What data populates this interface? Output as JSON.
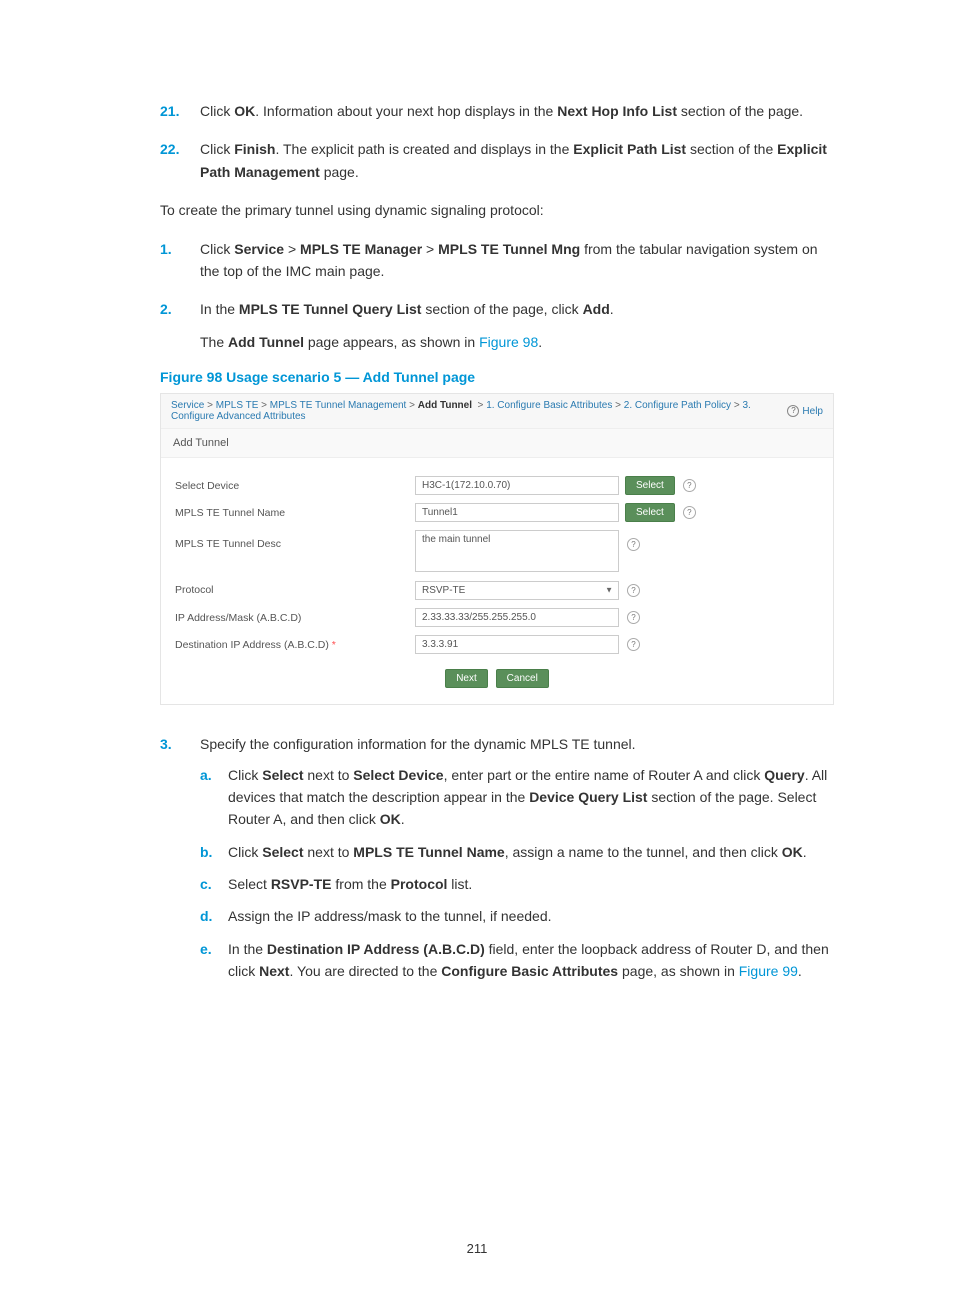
{
  "steps_top": [
    {
      "num": "21.",
      "html": "Click <b>OK</b>. Information about your next hop displays in the <b>Next Hop Info List</b> section of the page."
    },
    {
      "num": "22.",
      "html": "Click <b>Finish</b>. The explicit path is created and displays in the <b>Explicit Path List</b> section of the <b>Explicit Path Management</b> page."
    }
  ],
  "intro": "To create the primary tunnel using dynamic signaling protocol:",
  "steps_mid": [
    {
      "num": "1.",
      "html": "Click <b>Service</b> > <b>MPLS TE Manager</b> > <b>MPLS TE Tunnel Mng</b> from the tabular navigation system on the top of the IMC main page."
    },
    {
      "num": "2.",
      "html": "In the <b>MPLS TE Tunnel Query List</b> section of the page, click <b>Add</b>."
    }
  ],
  "step2_extra_html": "The <b>Add Tunnel</b> page appears, as shown in <span class=\"linkish\">Figure 98</span>.",
  "figure_caption": "Figure 98 Usage scenario 5 — Add Tunnel page",
  "screenshot": {
    "breadcrumb": {
      "service": "Service",
      "mpls_te": "MPLS TE",
      "mpls_te_tunnel_mgmt": "MPLS TE Tunnel Management",
      "add_tunnel": "Add Tunnel",
      "step1": "1. Configure Basic Attributes",
      "step2": "2. Configure Path Policy",
      "step3": "3. Configure Advanced Attributes",
      "help": "Help"
    },
    "panel_title": "Add Tunnel",
    "form": {
      "select_device": {
        "label": "Select Device",
        "value": "H3C-1(172.10.0.70)",
        "button": "Select"
      },
      "tunnel_name": {
        "label": "MPLS TE Tunnel Name",
        "value": "Tunnel1",
        "button": "Select"
      },
      "tunnel_desc": {
        "label": "MPLS TE Tunnel Desc",
        "value": "the main tunnel"
      },
      "protocol": {
        "label": "Protocol",
        "value": "RSVP-TE"
      },
      "ip_mask": {
        "label": "IP Address/Mask (A.B.C.D)",
        "value": "2.33.33.33/255.255.255.0"
      },
      "dest_ip": {
        "label": "Destination IP Address (A.B.C.D)",
        "value": "3.3.3.91",
        "required": "*"
      }
    },
    "buttons": {
      "next": "Next",
      "cancel": "Cancel"
    }
  },
  "step3": {
    "num": "3.",
    "lead": "Specify the configuration information for the dynamic MPLS TE tunnel.",
    "sub": [
      {
        "num": "a.",
        "html": "Click <b>Select</b> next to <b>Select Device</b>, enter part or the entire name of Router A and click <b>Query</b>. All devices that match the description appear in the <b>Device Query List</b> section of the page. Select Router A, and then click <b>OK</b>."
      },
      {
        "num": "b.",
        "html": "Click <b>Select</b> next to <b>MPLS TE Tunnel Name</b>, assign a name to the tunnel, and then click <b>OK</b>."
      },
      {
        "num": "c.",
        "html": "Select <b>RSVP-TE</b> from the <b>Protocol</b> list."
      },
      {
        "num": "d.",
        "html": "Assign the IP address/mask to the tunnel, if needed."
      },
      {
        "num": "e.",
        "html": "In the <b>Destination IP Address (A.B.C.D)</b> field, enter the loopback address of Router D, and then click <b>Next</b>. You are directed to the <b>Configure Basic Attributes</b> page, as shown in <span class=\"linkish\">Figure 99</span>."
      }
    ]
  },
  "page_number": "211"
}
